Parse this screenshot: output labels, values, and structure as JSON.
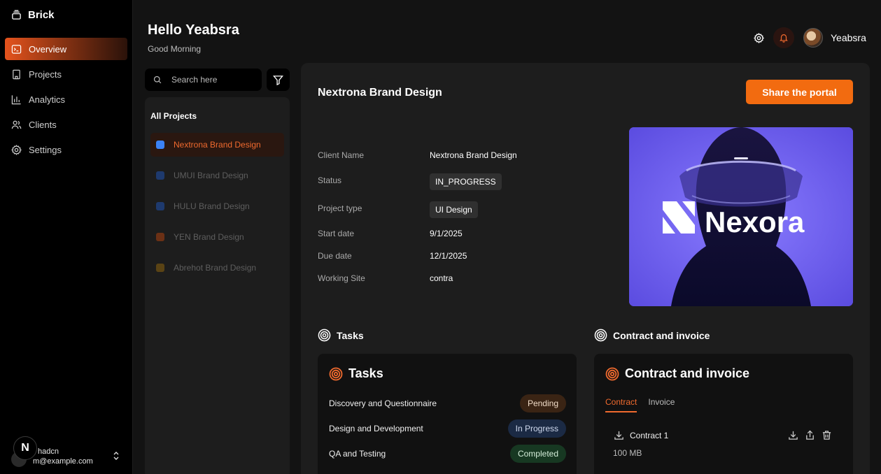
{
  "app": {
    "brand": "Brick"
  },
  "sidebar": {
    "items": [
      {
        "label": "Overview",
        "icon": "terminal-icon"
      },
      {
        "label": "Projects",
        "icon": "building-icon"
      },
      {
        "label": "Analytics",
        "icon": "bar-chart-icon"
      },
      {
        "label": "Clients",
        "icon": "users-icon"
      },
      {
        "label": "Settings",
        "icon": "gear-icon"
      }
    ],
    "active": "Overview",
    "user": {
      "name": "hadcn",
      "email": "m@example.com",
      "badge": "N"
    }
  },
  "header": {
    "greeting": "Hello Yeabsra",
    "subtitle": "Good Morning",
    "user_name": "Yeabsra"
  },
  "search": {
    "placeholder": "Search here"
  },
  "projects": {
    "title": "All Projects",
    "items": [
      {
        "name": "Nextrona Brand Design",
        "color": "#3b82f6",
        "active": true
      },
      {
        "name": "UMUI Brand Design",
        "color": "#1e3a6e"
      },
      {
        "name": "HULU Brand Design",
        "color": "#1e3a6e"
      },
      {
        "name": "YEN Brand Design",
        "color": "#6b3015"
      },
      {
        "name": "Abrehot Brand Design",
        "color": "#5a4314"
      }
    ]
  },
  "project": {
    "title": "Nextrona Brand Design",
    "share_label": "Share the portal",
    "details": {
      "client_name_label": "Client Name",
      "client_name": "Nextrona Brand Design",
      "status_label": "Status",
      "status": "IN_PROGRESS",
      "type_label": "Project type",
      "type": "UI Design",
      "start_label": "Start date",
      "start": "9/1/2025",
      "due_label": "Due date",
      "due": "12/1/2025",
      "site_label": "Working Site",
      "site": "contra"
    },
    "hero_logo_text": "Nexora"
  },
  "tasks": {
    "section_title": "Tasks",
    "card_title": "Tasks",
    "items": [
      {
        "name": "Discovery and Questionnaire",
        "status": "Pending"
      },
      {
        "name": "Design and Development",
        "status": "In Progress"
      },
      {
        "name": "QA and Testing",
        "status": "Completed"
      }
    ]
  },
  "contract": {
    "section_title": "Contract and invoice",
    "card_title": "Contract and invoice",
    "tabs": [
      "Contract",
      "Invoice"
    ],
    "active_tab": "Contract",
    "file": {
      "name": "Contract 1",
      "size": "100 MB"
    }
  },
  "colors": {
    "accent": "#f26b10",
    "background": "#131313",
    "panel": "#1d1d1d"
  }
}
